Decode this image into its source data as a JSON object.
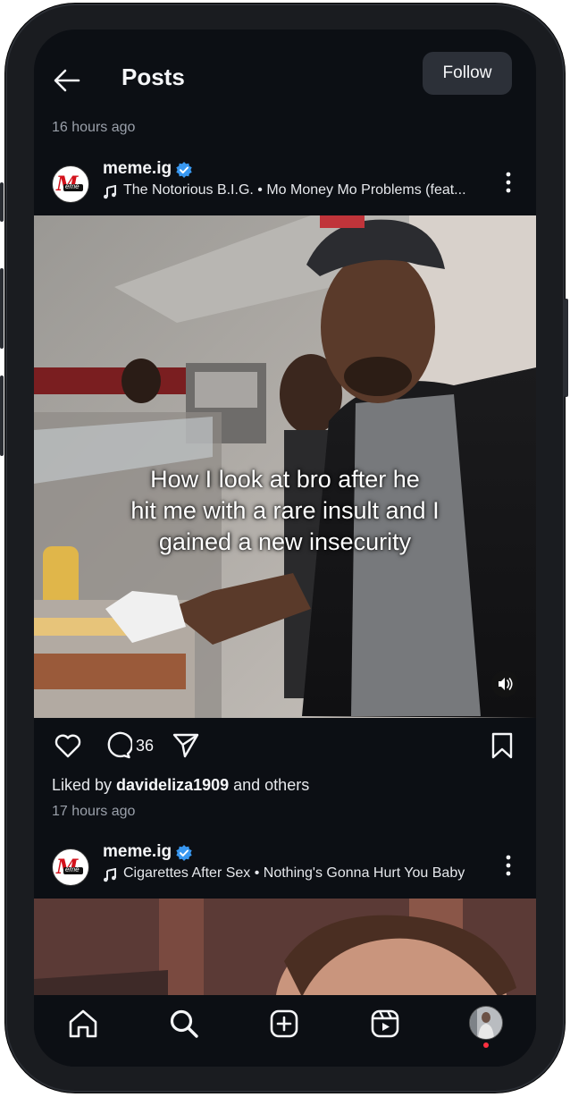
{
  "header": {
    "title": "Posts",
    "follow_label": "Follow"
  },
  "top_timestamp": "16 hours ago",
  "post1": {
    "username": "meme.ig",
    "song": "The Notorious B.I.G. • Mo Money Mo Problems (feat...",
    "overlay_lines": [
      "How I look at bro  after he",
      "hit me with a rare insult and I",
      "gained a new insecurity"
    ],
    "comment_count": "36",
    "liked_prefix": "Liked by ",
    "liked_user": "davideliza1909",
    "liked_suffix": " and others",
    "timestamp": "17 hours ago"
  },
  "post2": {
    "username": "meme.ig",
    "song": "Cigarettes After Sex • Nothing's Gonna Hurt You Baby"
  },
  "avatar_text": {
    "logo_letter": "M",
    "logo_bar": "eme"
  },
  "colors": {
    "background": "#0c0f14",
    "follow_button": "#2c3038",
    "verified": "#3897f0",
    "notification_dot": "#ff3040"
  },
  "icons": [
    "back-arrow-icon",
    "verified-icon",
    "music-note-icon",
    "more-icon",
    "audio-icon",
    "heart-icon",
    "comment-icon",
    "share-icon",
    "bookmark-icon",
    "home-icon",
    "search-icon",
    "create-icon",
    "reels-icon"
  ]
}
